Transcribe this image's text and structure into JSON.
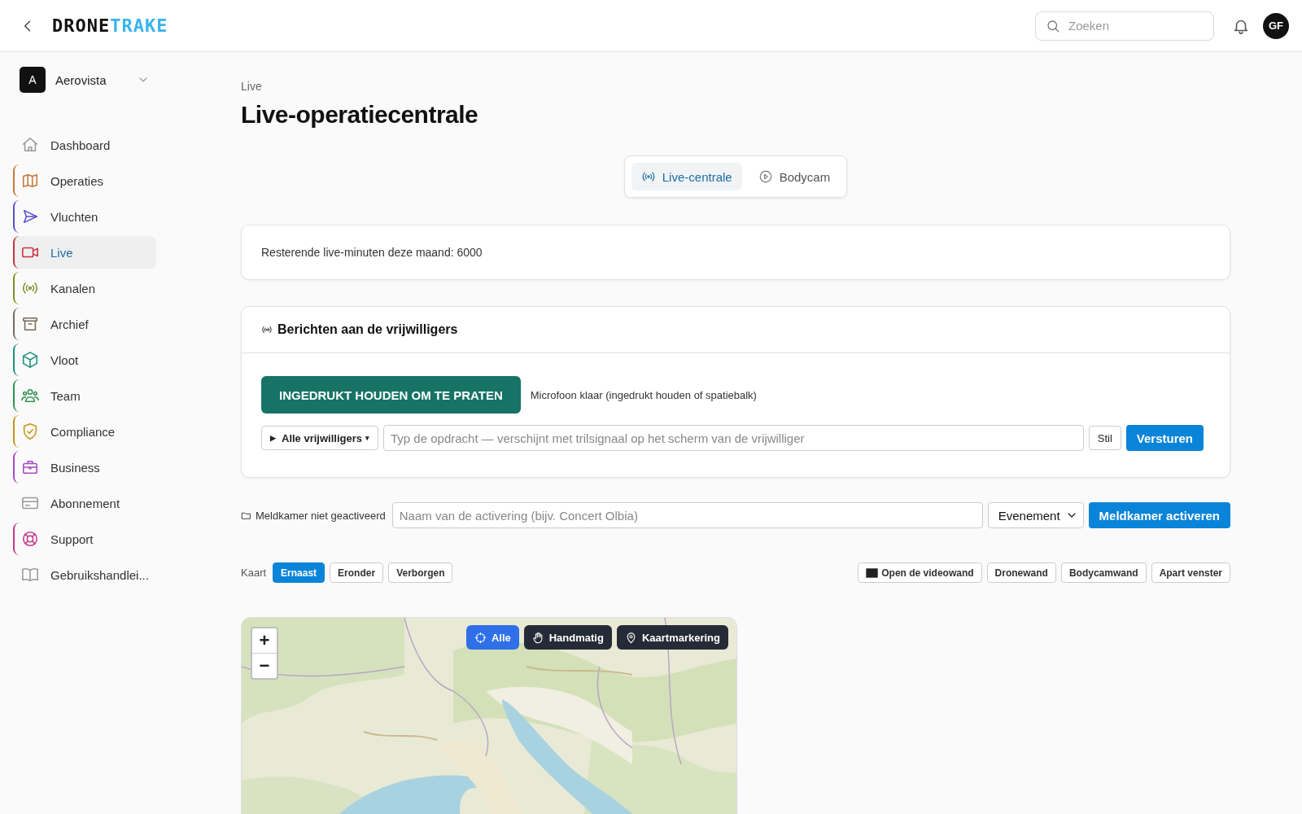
{
  "header": {
    "logo": {
      "part_1": "DRONE",
      "part_2": "TRAKE"
    },
    "search": {
      "placeholder": "Zoeken"
    },
    "avatar": "GF"
  },
  "sidebar": {
    "org": {
      "initial": "A",
      "name": "Aerovista"
    },
    "items": [
      {
        "label": "Dashboard",
        "selected": false
      },
      {
        "label": "Operaties",
        "color": "#c77a3a",
        "selected": false
      },
      {
        "label": "Vluchten",
        "color": "#5b4fcf",
        "selected": false
      },
      {
        "label": "Live",
        "color": "#c8323e",
        "selected": true
      },
      {
        "label": "Kanalen",
        "color": "#7a8f2a",
        "selected": false
      },
      {
        "label": "Archief",
        "color": "#7b6a5c",
        "selected": false
      },
      {
        "label": "Vloot",
        "color": "#1f9080",
        "selected": false
      },
      {
        "label": "Team",
        "color": "#2f9350",
        "selected": false
      },
      {
        "label": "Compliance",
        "color": "#c2961c",
        "selected": false
      },
      {
        "label": "Business",
        "color": "#a64cc4",
        "selected": false
      },
      {
        "label": "Abonnement",
        "selected": false
      },
      {
        "label": "Support",
        "color": "#c23a8a",
        "selected": false
      },
      {
        "label": "Gebruikshandlei...",
        "selected": false
      }
    ]
  },
  "breadcrumb": "Live",
  "title": "Live-operatiecentrale",
  "tabs": [
    {
      "label": "Live-centrale",
      "selected": true
    },
    {
      "label": "Bodycam",
      "selected": false
    }
  ],
  "info": "Resterende live-minuten deze maand: 6000",
  "messages": {
    "title": "Berichten aan de vrijwilligers",
    "talk_button": "INGEDRUKT HOUDEN OM TE PRATEN",
    "mic_status": "Microfoon klaar (ingedrukt houden of spatiebalk)",
    "recipient": "Alle vrijwilligers",
    "recipient_marker": "▶",
    "recipient_caret": "▾",
    "placeholder": "Typ de opdracht — verschijnt met trilsignaal op het scherm van de vrijwilliger",
    "silent_button": "Stil",
    "send_button": "Versturen"
  },
  "dispatch": {
    "status": "Meldkamer niet geactiveerd",
    "placeholder": "Naam van de activering (bijv. Concert Olbia)",
    "type": "Evenement",
    "button": "Meldkamer activeren"
  },
  "map_layout": {
    "label": "Kaart",
    "options": [
      {
        "label": "Ernaast",
        "selected": true
      },
      {
        "label": "Eronder",
        "selected": false
      },
      {
        "label": "Verborgen",
        "selected": false
      }
    ]
  },
  "walls": [
    "Open de videowand",
    "Dronewand",
    "Bodycamwand",
    "Apart venster"
  ],
  "map": {
    "kind": "picture",
    "zoom_in": "+",
    "zoom_out": "−",
    "modes": [
      {
        "label": "Alle",
        "selected": true
      },
      {
        "label": "Handmatig",
        "selected": false
      },
      {
        "label": "Kaartmarkering",
        "selected": false
      }
    ]
  }
}
